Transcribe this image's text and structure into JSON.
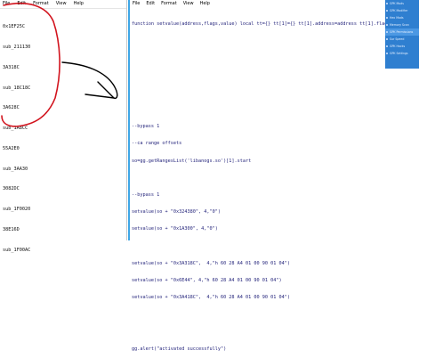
{
  "left_window": {
    "menu": [
      "File",
      "Edit",
      "Format",
      "View",
      "Help"
    ],
    "lines": [
      "0x1EF25C",
      "sub_211130",
      "3A318C",
      "sub_18C18C",
      "3A628C",
      "sub_1A8CC",
      "55A2E0",
      "sub_3AA30",
      "3082DC",
      "sub_1F0020",
      "38E16D",
      "sub_1F00AC"
    ]
  },
  "right_window": {
    "menu": [
      "File",
      "Edit",
      "Format",
      "View",
      "Help"
    ],
    "code_lines": [
      "function setvalue(address,flags,value) local tt={} tt[1]={} tt[1].address=address tt[1].flags=flags tt[1]",
      "",
      "",
      "",
      "",
      "",
      "--bypass 1",
      "--ca range offsets",
      "so=gg.getRangesList('libanogs.so')[1].start",
      "",
      "--bypass 1",
      "setvalue(so + \"0x324380\", 4,\"0\")",
      "setvalue(so + \"0x1A300\", 4,\"0\")",
      "",
      "setvalue(so + \"0x3A318C\",  4,\"h 60 28 A4 01 00 90 01 04\")",
      "setvalue(so + \"0x6E44\", 4,\"h 60 28 A4 01 00 90 01 04\")",
      "setvalue(so + \"0x3A418C\",  4,\"h 60 28 A4 01 00 90 01 04\")",
      "",
      "",
      "gg.alert(\"activated successfully\")"
    ]
  },
  "side_panel": {
    "items": [
      "GPK Mods",
      "GPK Modifier",
      "Hex Mods",
      "Memory Scan",
      "GPK Permissions",
      "Sur Speed",
      "GPK Hacks",
      "GPK Settings"
    ]
  },
  "colors": {
    "scroll": "#3ea6e6",
    "panel": "#2f7fd0",
    "annotation_red": "#d2141e"
  }
}
